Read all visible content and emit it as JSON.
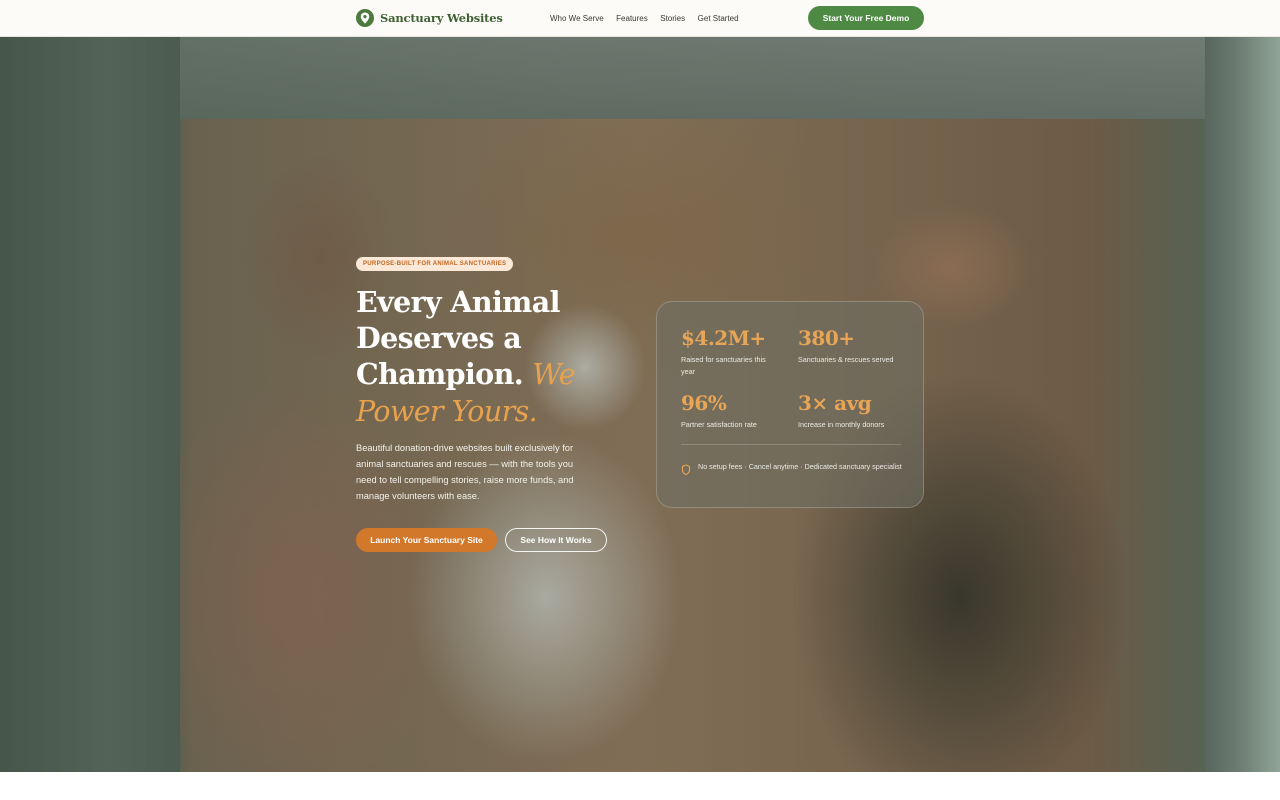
{
  "nav": {
    "brand": "Sanctuary Websites",
    "links": [
      "Who We Serve",
      "Features",
      "Stories",
      "Get Started"
    ],
    "cta": "Start Your Free Demo"
  },
  "hero": {
    "badge": "PURPOSE-BUILT FOR ANIMAL SANCTUARIES",
    "headline_main": "Every Animal Deserves a Champion.",
    "headline_accent": "We Power Yours.",
    "subtext": "Beautiful donation-drive websites built exclusively for animal sanctuaries and rescues — with the tools you need to tell compelling stories, raise more funds, and manage volunteers with ease.",
    "primary_button": "Launch Your Sanctuary Site",
    "secondary_button": "See How It Works"
  },
  "stats": {
    "items": [
      {
        "value": "$4.2M+",
        "label": "Raised for sanctuaries this year"
      },
      {
        "value": "380+",
        "label": "Sanctuaries & rescues served"
      },
      {
        "value": "96%",
        "label": "Partner satisfaction rate"
      },
      {
        "value": "3× avg",
        "label": "Increase in monthly donors"
      }
    ],
    "note": "No setup fees · Cancel anytime · Dedicated sanctuary specialist",
    "accent_color": "#e9a556"
  },
  "icons": {
    "brand": "map-pin-icon",
    "note": "shield-icon"
  },
  "colors": {
    "brand_green": "#4f8a45",
    "accent_orange": "#d2782a",
    "badge_bg": "#fbe8d6"
  }
}
